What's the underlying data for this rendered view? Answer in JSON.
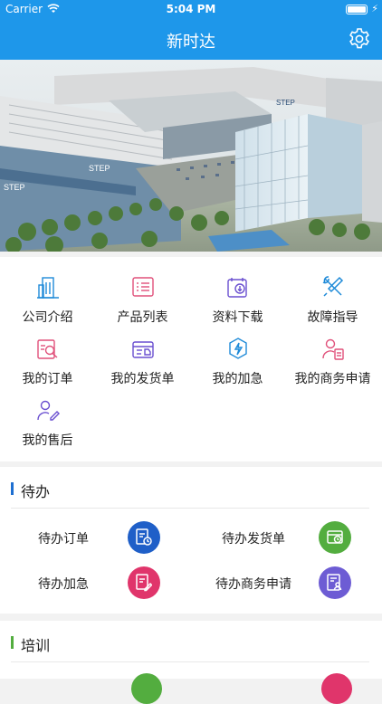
{
  "status": {
    "carrier": "Carrier",
    "time": "5:04 PM"
  },
  "nav": {
    "title": "新时达"
  },
  "banner": {
    "sign1": "STEP",
    "sign2": "STEP",
    "sign3": "STEP"
  },
  "menu": [
    {
      "label": "公司介绍",
      "icon": "building-icon"
    },
    {
      "label": "产品列表",
      "icon": "list-icon"
    },
    {
      "label": "资料下载",
      "icon": "download-icon"
    },
    {
      "label": "故障指导",
      "icon": "tools-icon"
    },
    {
      "label": "我的订单",
      "icon": "order-search-icon"
    },
    {
      "label": "我的发货单",
      "icon": "delivery-box-icon"
    },
    {
      "label": "我的加急",
      "icon": "lightning-icon"
    },
    {
      "label": "我的商务申请",
      "icon": "person-document-icon"
    },
    {
      "label": "我的售后",
      "icon": "person-edit-icon"
    }
  ],
  "todo": {
    "title": "待办",
    "items": [
      {
        "label": "待办订单",
        "icon": "order-clock-icon",
        "color": "#1f5fc8"
      },
      {
        "label": "待办发货单",
        "icon": "box-clock-icon",
        "color": "#53ad3f"
      },
      {
        "label": "待办加急",
        "icon": "document-edit-icon",
        "color": "#e0356b"
      },
      {
        "label": "待办商务申请",
        "icon": "document-person-icon",
        "color": "#6d5cd4"
      }
    ]
  },
  "training": {
    "title": "培训"
  },
  "colors": {
    "primary": "#1e97ea",
    "accent_bar_todo": "#1e6fd1",
    "accent_bar_training": "#53ad3f"
  }
}
